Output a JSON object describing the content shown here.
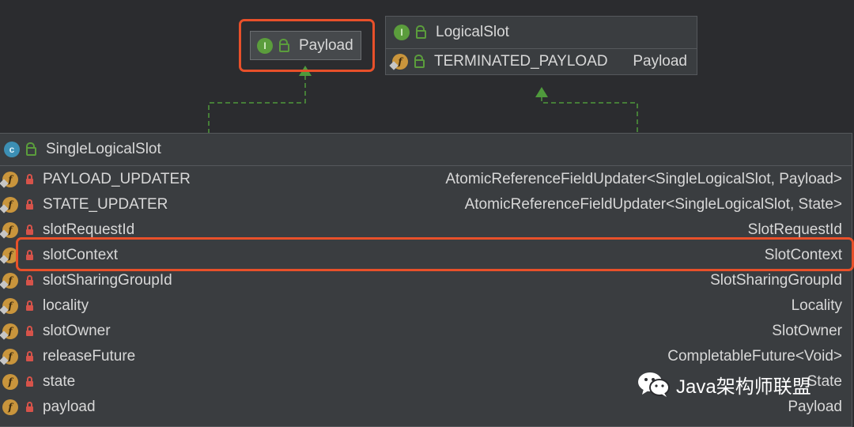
{
  "payload_box": {
    "title": "Payload"
  },
  "logical_slot": {
    "title": "LogicalSlot",
    "field": {
      "name": "TERMINATED_PAYLOAD",
      "type": "Payload"
    }
  },
  "single_logical_slot": {
    "title": "SingleLogicalSlot",
    "fields": [
      {
        "name": "PAYLOAD_UPDATER",
        "type": "AtomicReferenceFieldUpdater<SingleLogicalSlot, Payload>"
      },
      {
        "name": "STATE_UPDATER",
        "type": "AtomicReferenceFieldUpdater<SingleLogicalSlot, State>"
      },
      {
        "name": "slotRequestId",
        "type": "SlotRequestId"
      },
      {
        "name": "slotContext",
        "type": "SlotContext"
      },
      {
        "name": "slotSharingGroupId",
        "type": "SlotSharingGroupId"
      },
      {
        "name": "locality",
        "type": "Locality"
      },
      {
        "name": "slotOwner",
        "type": "SlotOwner"
      },
      {
        "name": "releaseFuture",
        "type": "CompletableFuture<Void>"
      },
      {
        "name": "state",
        "type": "State"
      },
      {
        "name": "payload",
        "type": "Payload"
      }
    ]
  },
  "watermark": {
    "text": "Java架构师联盟"
  },
  "colors": {
    "highlight": "#e8502a",
    "arrow": "#4f9a3c"
  }
}
